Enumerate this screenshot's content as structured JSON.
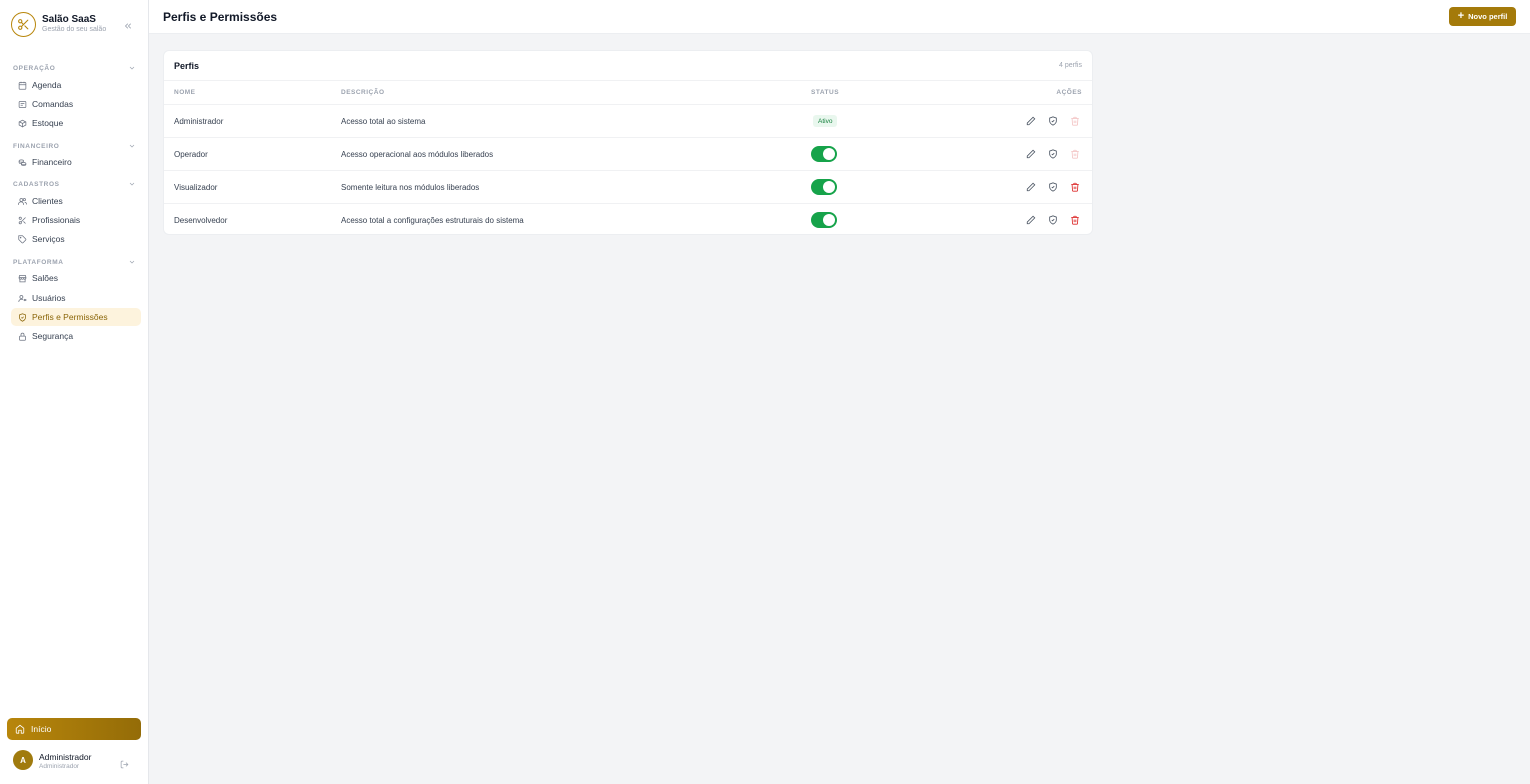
{
  "brand": {
    "name": "Salão SaaS",
    "subtitle": "Gestão do seu salão"
  },
  "sections": [
    {
      "label": "OPERAÇÃO",
      "items": [
        {
          "label": "Agenda",
          "icon": "calendar-icon"
        },
        {
          "label": "Comandas",
          "icon": "receipt-icon"
        },
        {
          "label": "Estoque",
          "icon": "box-icon"
        }
      ]
    },
    {
      "label": "FINANCEIRO",
      "items": [
        {
          "label": "Financeiro",
          "icon": "coins-icon"
        }
      ]
    },
    {
      "label": "CADASTROS",
      "items": [
        {
          "label": "Clientes",
          "icon": "users-icon"
        },
        {
          "label": "Profissionais",
          "icon": "scissors-icon"
        },
        {
          "label": "Serviços",
          "icon": "tag-icon"
        }
      ]
    },
    {
      "label": "PLATAFORMA",
      "items": [
        {
          "label": "Salões",
          "icon": "store-icon"
        },
        {
          "label": "Usuários",
          "icon": "user-key-icon"
        },
        {
          "label": "Perfis e Permissões",
          "icon": "shield-check-icon",
          "active": true
        },
        {
          "label": "Segurança",
          "icon": "lock-icon"
        }
      ]
    }
  ],
  "home": {
    "label": "Início"
  },
  "user": {
    "initial": "A",
    "name": "Administrador",
    "role": "Administrador"
  },
  "header": {
    "title": "Perfis e Permissões",
    "new_button": "Novo perfil"
  },
  "card": {
    "title": "Perfis",
    "count": "4 perfis",
    "columns": {
      "name": "NOME",
      "description": "DESCRIÇÃO",
      "status": "STATUS",
      "actions": "AÇÕES"
    },
    "rows": [
      {
        "name": "Administrador",
        "description": "Acesso total ao sistema",
        "status": "Ativo",
        "status_kind": "badge",
        "delete_enabled": false
      },
      {
        "name": "Operador",
        "description": "Acesso operacional aos módulos liberados",
        "status_kind": "toggle",
        "status_on": true,
        "delete_enabled": false
      },
      {
        "name": "Visualizador",
        "description": "Somente leitura nos módulos liberados",
        "status_kind": "toggle",
        "status_on": true,
        "delete_enabled": true
      },
      {
        "name": "Desenvolvedor",
        "description": "Acesso total a configurações estruturais do sistema",
        "status_kind": "toggle",
        "status_on": true,
        "delete_enabled": true
      }
    ]
  },
  "colors": {
    "accent": "#b8860b",
    "accent_dark": "#946c08",
    "active_bg": "#fdf3dd",
    "success": "#16a34a",
    "danger": "#dc2626",
    "danger_disabled": "#f3c4c4"
  }
}
